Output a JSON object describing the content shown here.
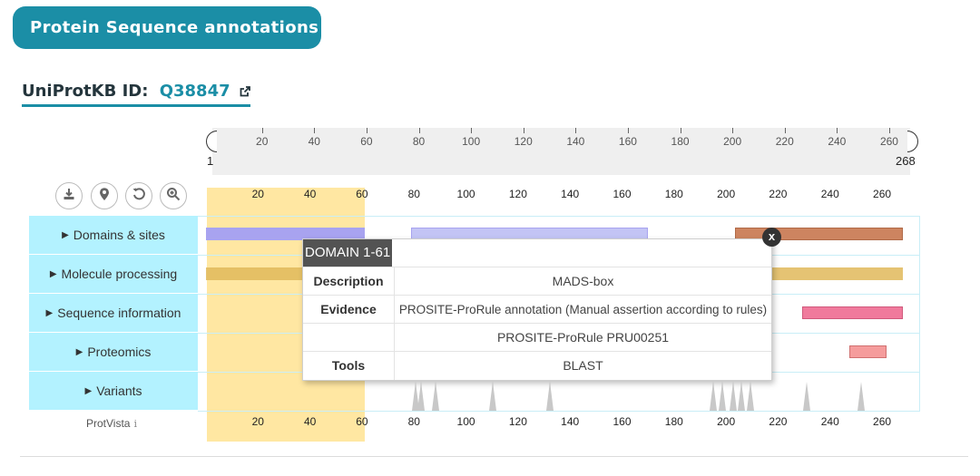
{
  "header": {
    "title": "Protein Sequence annotations"
  },
  "uniprot": {
    "label": "UniProtKB ID:",
    "id": "Q38847",
    "external_icon": "external-link-icon"
  },
  "navigation": {
    "start": "1",
    "end": "268",
    "ticks": [
      "20",
      "40",
      "60",
      "80",
      "100",
      "120",
      "140",
      "160",
      "180",
      "200",
      "220",
      "240",
      "260"
    ]
  },
  "tools": [
    "download-icon",
    "location-pin-icon",
    "reset-icon",
    "zoom-in-icon"
  ],
  "axis_ticks": [
    "20",
    "40",
    "60",
    "80",
    "100",
    "120",
    "140",
    "160",
    "180",
    "200",
    "220",
    "240",
    "260"
  ],
  "categories": [
    {
      "label": "Domains & sites"
    },
    {
      "label": "Molecule processing"
    },
    {
      "label": "Sequence information"
    },
    {
      "label": "Proteomics"
    },
    {
      "label": "Variants"
    }
  ],
  "colors": {
    "header_bg": "#1b8ea6",
    "category_bg": "#b3f2ff",
    "highlight": "#ffe392",
    "domain_bar": "#a8a3f0",
    "domain_bar_light": "#c3c4f5",
    "domain_bar_brown": "#cd8460",
    "processing_bar": "#e0b95a",
    "seqinfo_bar": "#f07a9c",
    "proteomics_bar": "#f59c9c"
  },
  "footer": {
    "label": "ProtVista",
    "info_icon": "info-icon"
  },
  "tooltip": {
    "title": "DOMAIN 1-61",
    "close": "x",
    "rows": [
      {
        "key": "Description",
        "value": "MADS-box"
      },
      {
        "key": "Evidence",
        "value": "PROSITE-ProRule annotation (Manual assertion according to rules)"
      },
      {
        "key": "",
        "value": "PROSITE-ProRule PRU00251"
      },
      {
        "key": "Tools",
        "value": "BLAST"
      }
    ]
  }
}
